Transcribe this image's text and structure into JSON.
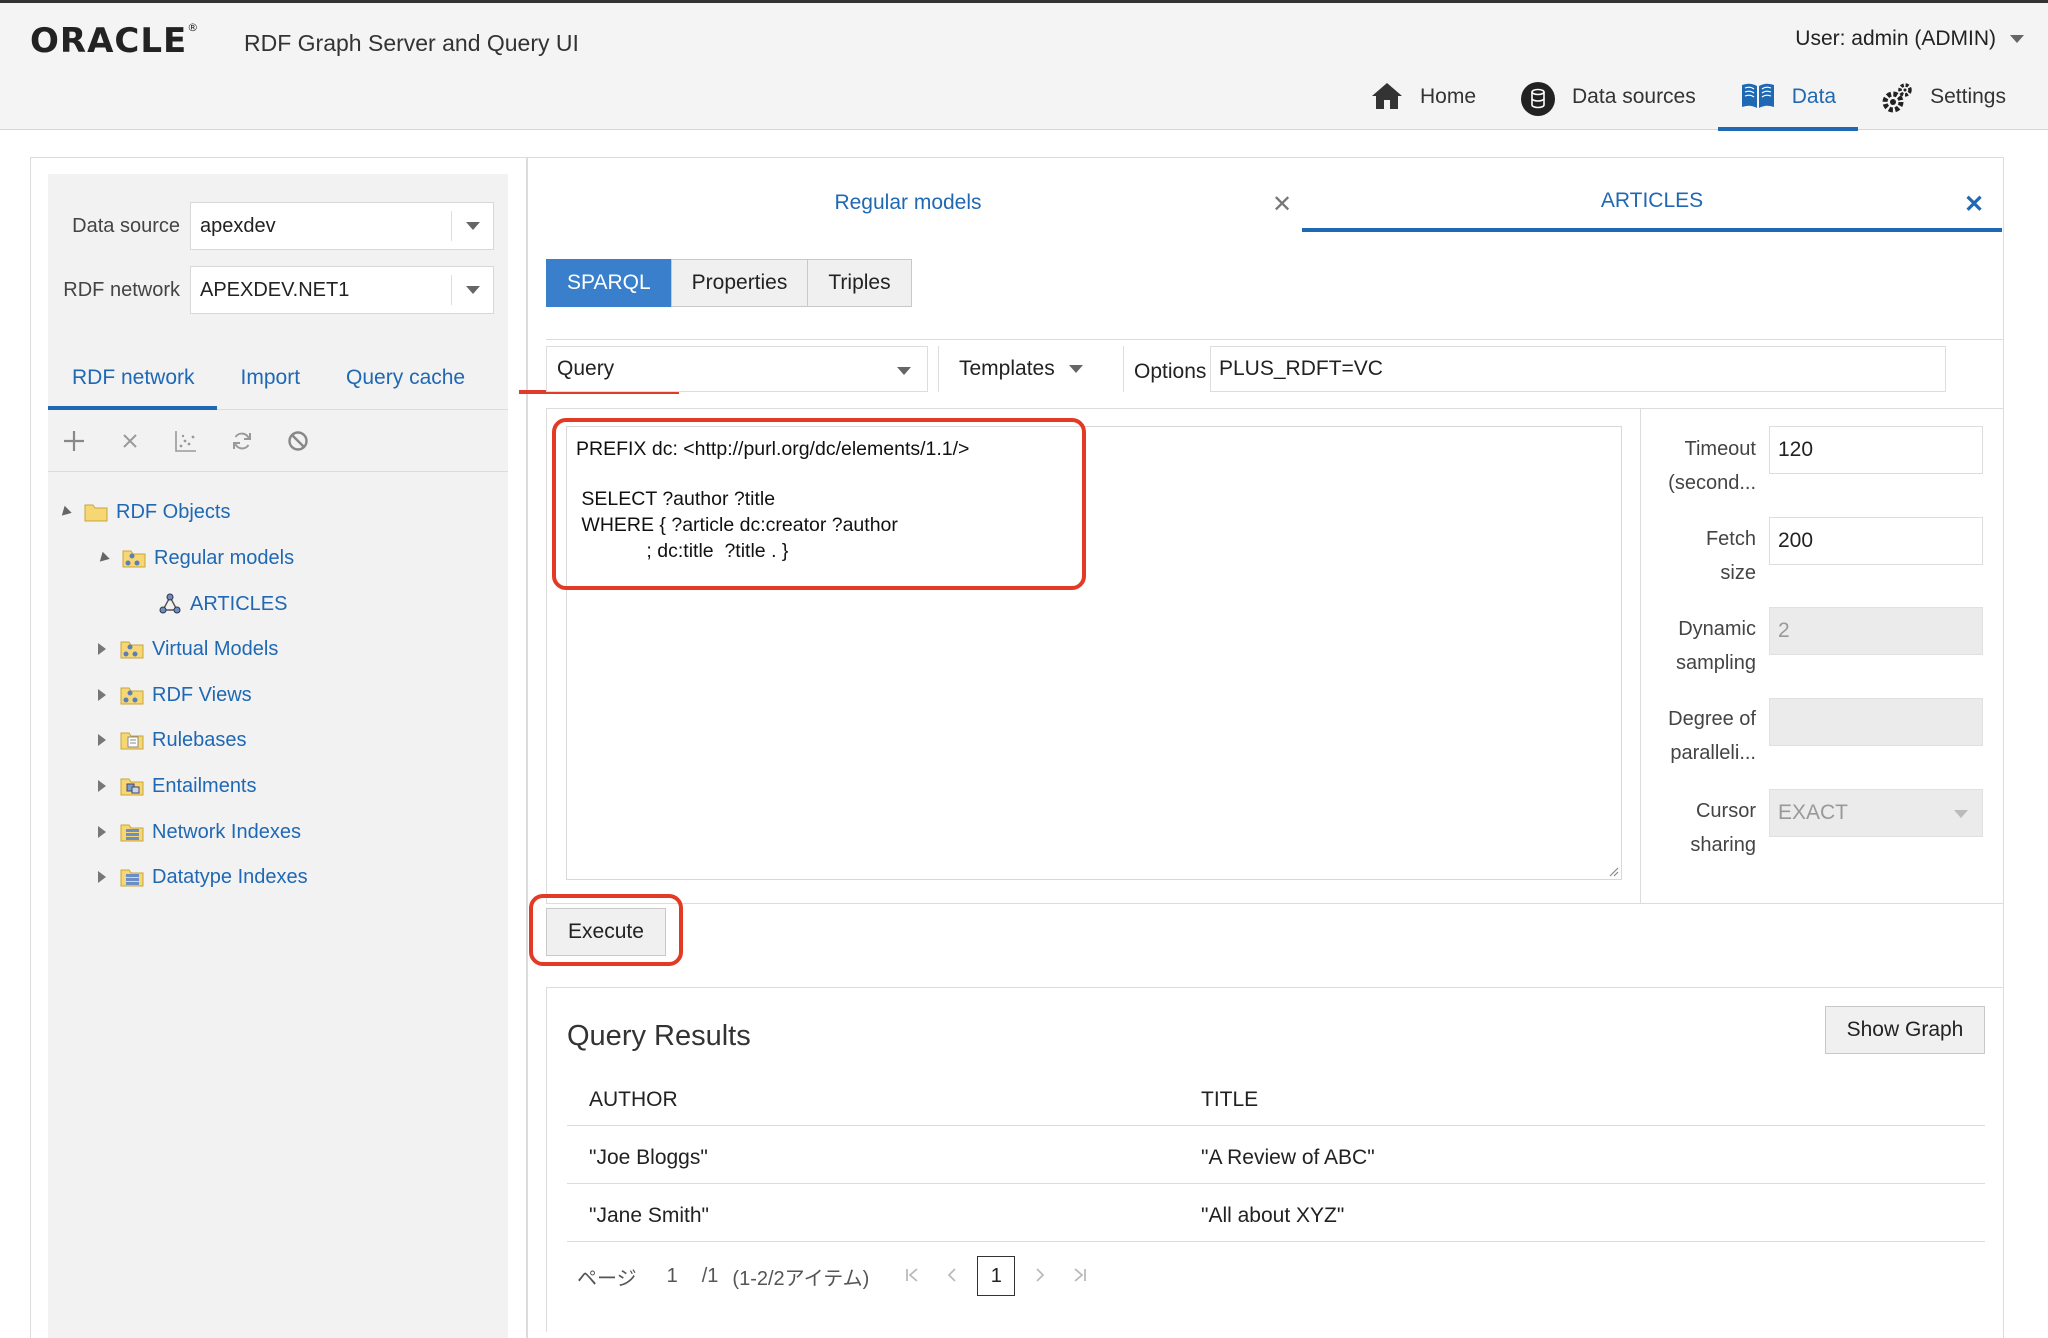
{
  "header": {
    "logo": "ORACLE",
    "app_title": "RDF Graph Server and Query UI",
    "user": "User: admin (ADMIN)",
    "nav": [
      {
        "label": "Home",
        "icon": "home-icon"
      },
      {
        "label": "Data sources",
        "icon": "database-icon"
      },
      {
        "label": "Data",
        "icon": "book-icon"
      },
      {
        "label": "Settings",
        "icon": "gear-icon"
      }
    ]
  },
  "sidebar": {
    "data_source_label": "Data source",
    "data_source_value": "apexdev",
    "rdf_network_label": "RDF network",
    "rdf_network_value": "APEXDEV.NET1",
    "tabs": [
      "RDF network",
      "Import",
      "Query cache"
    ],
    "toolbar_icons": [
      "plus-icon",
      "close-icon",
      "chart-icon",
      "refresh-icon",
      "block-icon"
    ],
    "tree": {
      "root": "RDF Objects",
      "regular_models": "Regular models",
      "articles": "ARTICLES",
      "virtual_models": "Virtual Models",
      "rdf_views": "RDF Views",
      "rulebases": "Rulebases",
      "entailments": "Entailments",
      "network_indexes": "Network Indexes",
      "datatype_indexes": "Datatype Indexes"
    }
  },
  "main": {
    "tabs": [
      {
        "label": "Regular models"
      },
      {
        "label": "ARTICLES"
      }
    ],
    "close_glyph": "✕",
    "subtabs": [
      "SPARQL",
      "Properties",
      "Triples"
    ],
    "query_type": "Query",
    "templates_label": "Templates",
    "options_label": "Options",
    "options_value": "PLUS_RDFT=VC",
    "query_lines": [
      "PREFIX dc: <http://purl.org/dc/elements/1.1/>",
      "",
      " SELECT ?author ?title",
      " WHERE { ?article dc:creator ?author",
      "             ; dc:title  ?title . }"
    ],
    "settings": {
      "timeout_label_1": "Timeout",
      "timeout_label_2": "(second...",
      "timeout_value": "120",
      "fetch_label_1": "Fetch",
      "fetch_label_2": "size",
      "fetch_value": "200",
      "dynamic_label_1": "Dynamic",
      "dynamic_label_2": "sampling",
      "dynamic_value": "2",
      "degree_label_1": "Degree of",
      "degree_label_2": "paralleli...",
      "degree_value": "",
      "cursor_label_1": "Cursor",
      "cursor_label_2": "sharing",
      "cursor_value": "EXACT"
    },
    "execute_label": "Execute"
  },
  "results": {
    "title": "Query Results",
    "show_graph_label": "Show Graph",
    "columns": [
      "AUTHOR",
      "TITLE"
    ],
    "rows": [
      [
        "\"Joe Bloggs\"",
        "\"A Review of ABC\""
      ],
      [
        "\"Jane Smith\"",
        "\"All about XYZ\""
      ]
    ],
    "pager": {
      "page_label": "ページ",
      "page": "1",
      "total": "/1",
      "summary": "(1-2/2アイテム)",
      "current": "1"
    }
  }
}
